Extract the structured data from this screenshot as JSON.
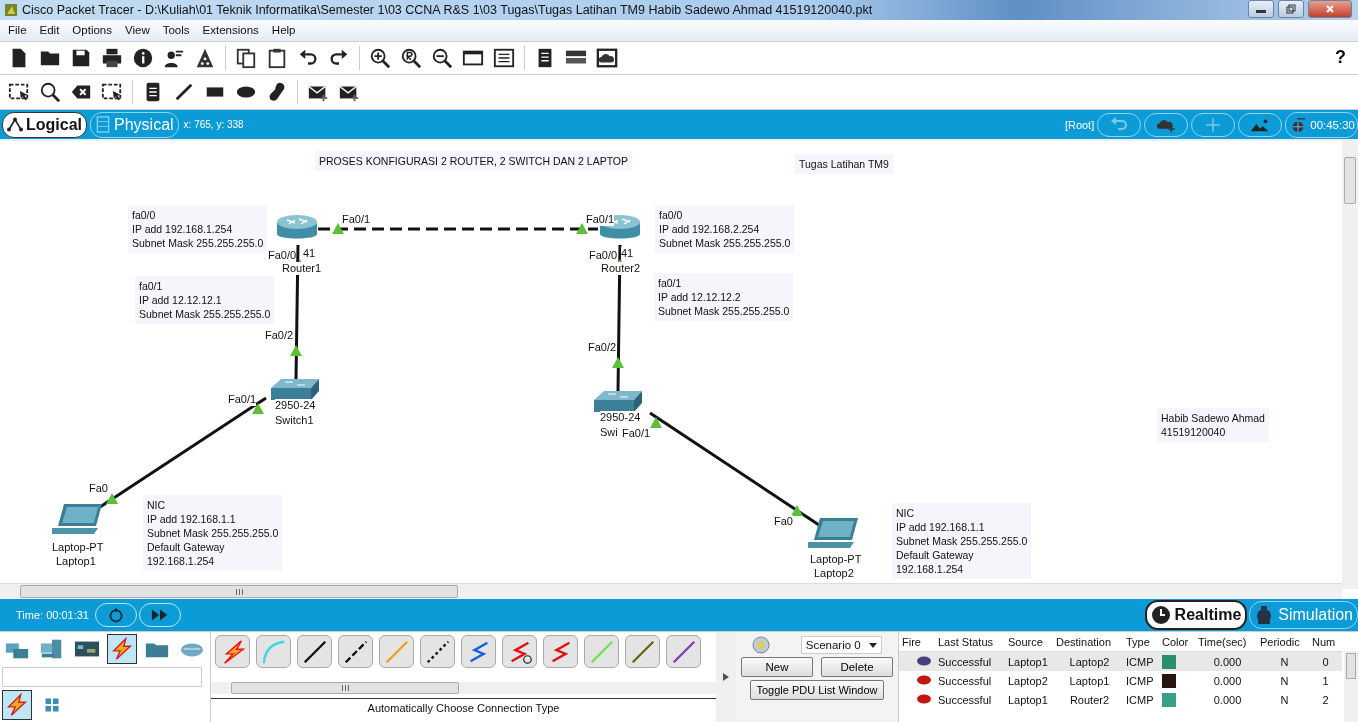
{
  "window": {
    "title": "Cisco Packet Tracer - D:\\Kuliah\\01 Teknik Informatika\\Semester 1\\03 CCNA R&S 1\\03 Tugas\\Tugas Latihan TM9 Habib Sadewo Ahmad 41519120040.pkt"
  },
  "menu": [
    "File",
    "Edit",
    "Options",
    "View",
    "Tools",
    "Extensions",
    "Help"
  ],
  "help": "?",
  "workspace_tabs": [
    {
      "label": "Logical",
      "selected": true
    },
    {
      "label": "Physical",
      "selected": false
    }
  ],
  "coordinates": "x: 765, y: 338",
  "root": "[Root]",
  "clock": "00:45:30",
  "canvas": {
    "notes": [
      {
        "lines": [
          "PROSES KONFIGURASI 2 ROUTER, 2 SWITCH DAN 2 LAPTOP"
        ]
      },
      {
        "lines": [
          "Tugas Latihan TM9"
        ]
      },
      {
        "lines": [
          "fa0/0",
          "IP add 192.168.1.254",
          "Subnet Mask 255.255.255.0"
        ]
      },
      {
        "lines": [
          "fa0/1",
          "IP add 12.12.12.1",
          "Subnet Mask 255.255.255.0"
        ]
      },
      {
        "lines": [
          "fa0/0",
          "IP add 192.168.2.254",
          "Subnet Mask 255.255.255.0"
        ]
      },
      {
        "lines": [
          "fa0/1",
          "IP add 12.12.12.2",
          "Subnet Mask 255.255.255.0"
        ]
      },
      {
        "lines": [
          "NIC",
          "IP add 192.168.1.1",
          "Subnet Mask 255.255.255.0",
          "Default Gateway",
          "192.168.1.254"
        ]
      },
      {
        "lines": [
          "NIC",
          "IP add 192.168.1.1",
          "Subnet Mask 255.255.255.0",
          "Default Gateway",
          "192.168.1.254"
        ]
      },
      {
        "lines": [
          "Habib Sadewo Ahmad",
          "41519120040"
        ]
      }
    ],
    "devices": [
      {
        "kind": "router",
        "model": "41",
        "name": "Router1"
      },
      {
        "kind": "router",
        "model": "41",
        "name": "Router2"
      },
      {
        "kind": "switch",
        "model": "2950-24",
        "name": "Switch1"
      },
      {
        "kind": "switch",
        "model": "2950-24",
        "name": "Swi"
      },
      {
        "kind": "laptop",
        "model": "Laptop-PT",
        "name": "Laptop1"
      },
      {
        "kind": "laptop",
        "model": "Laptop-PT",
        "name": "Laptop2"
      }
    ],
    "links": [
      {
        "kind": "dashed",
        "up": true,
        "ports": [
          "Fa0/1",
          "Fa0/1"
        ]
      },
      {
        "kind": "solid",
        "up": true,
        "ports": [
          "Fa0/0",
          "Fa0/2"
        ]
      },
      {
        "kind": "solid",
        "up": true,
        "ports": [
          "Fa0/0",
          "Fa0/2"
        ]
      },
      {
        "kind": "solid",
        "up": true,
        "ports": [
          "Fa0/1",
          "Fa0"
        ]
      },
      {
        "kind": "solid",
        "up": true,
        "ports": [
          "Fa0/1",
          "Fa0"
        ]
      }
    ]
  },
  "time": "Time: 00:01:31",
  "mode_tabs": [
    {
      "label": "Realtime",
      "kind": "realtime",
      "selected": true
    },
    {
      "label": "Simulation",
      "kind": "simulation",
      "selected": false
    }
  ],
  "device_categories": [
    {
      "kind": "router",
      "selected": false
    },
    {
      "kind": "end-device",
      "selected": false
    },
    {
      "kind": "component",
      "selected": false
    },
    {
      "kind": "connection",
      "selected": true
    },
    {
      "kind": "misc",
      "selected": false
    },
    {
      "kind": "multiuser",
      "selected": false
    }
  ],
  "device_subtypes": [
    {
      "kind": "auto",
      "selected": true
    },
    {
      "kind": "grid",
      "selected": false
    }
  ],
  "connections": [
    {
      "kind": "auto"
    },
    {
      "kind": "console"
    },
    {
      "kind": "straight"
    },
    {
      "kind": "cross"
    },
    {
      "kind": "fiber"
    },
    {
      "kind": "phone"
    },
    {
      "kind": "coaxial"
    },
    {
      "kind": "serial-dce"
    },
    {
      "kind": "serial-dte"
    },
    {
      "kind": "octal"
    },
    {
      "kind": "iot"
    },
    {
      "kind": "usb"
    }
  ],
  "connection_status": "Automatically Choose Connection Type",
  "scenario": {
    "value": "Scenario 0",
    "buttons": [
      "New",
      "Delete"
    ],
    "toggle": "Toggle PDU List Window"
  },
  "pdu_table": {
    "columns": [
      "Fire",
      "Last Status",
      "Source",
      "Destination",
      "Type",
      "Color",
      "Time(sec)",
      "Periodic",
      "Num"
    ],
    "rows": [
      {
        "selected": true,
        "last_status": "Successful",
        "source": "Laptop1",
        "destination": "Laptop2",
        "type": "ICMP",
        "color": "#2a8f6a",
        "time": "0.000",
        "periodic": "N",
        "num": "0"
      },
      {
        "selected": false,
        "last_status": "Successful",
        "source": "Laptop2",
        "destination": "Laptop1",
        "type": "ICMP",
        "color": "#2a1512",
        "time": "0.000",
        "periodic": "N",
        "num": "1"
      },
      {
        "selected": false,
        "last_status": "Successful",
        "source": "Laptop1",
        "destination": "Router2",
        "type": "ICMP",
        "color": "#3a9e88",
        "time": "0.000",
        "periodic": "N",
        "num": "2"
      }
    ]
  }
}
